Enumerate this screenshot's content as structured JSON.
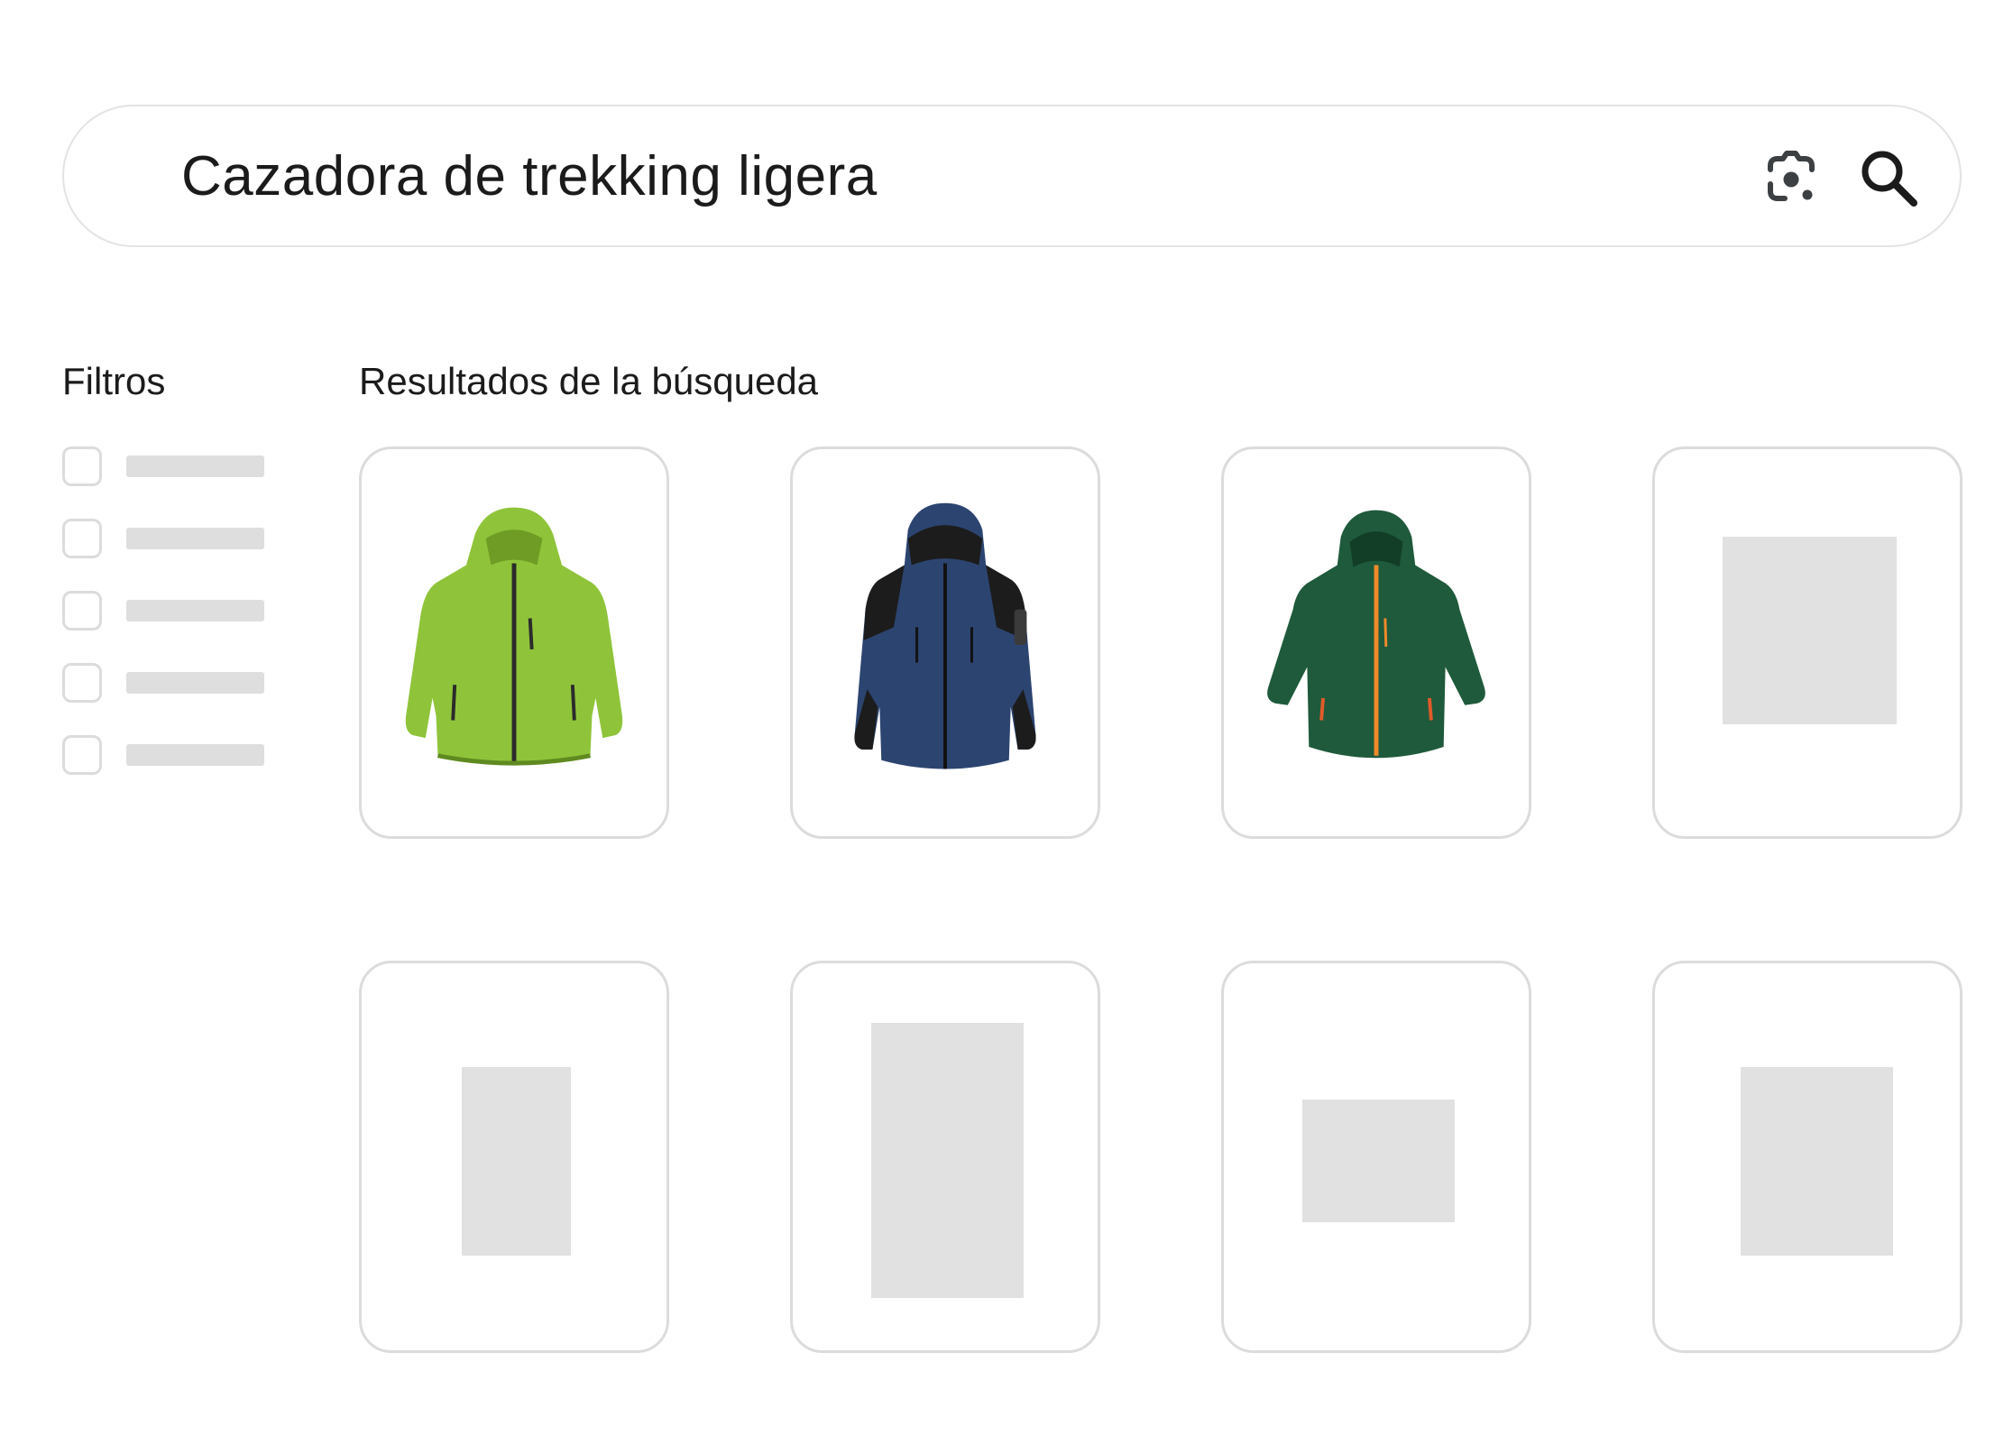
{
  "search": {
    "query": "Cazadora de trekking ligera",
    "lens_icon": "camera-lens-icon",
    "search_icon": "search-icon"
  },
  "filters": {
    "title": "Filtros",
    "items": [
      {
        "checked": false
      },
      {
        "checked": false
      },
      {
        "checked": false
      },
      {
        "checked": false
      },
      {
        "checked": false
      }
    ]
  },
  "results": {
    "title": "Resultados de la búsqueda",
    "products": [
      {
        "image": "green-lime-jacket",
        "colors": {
          "main": "#8fc43a",
          "zip": "#2b2b2b"
        }
      },
      {
        "image": "navy-softshell-jacket",
        "colors": {
          "main": "#2c4470",
          "panel": "#1c1c1c"
        }
      },
      {
        "image": "forest-green-jacket",
        "colors": {
          "main": "#1e5a3b",
          "zip": "#f08a2a"
        }
      },
      {
        "image": "placeholder"
      },
      {
        "image": "placeholder"
      },
      {
        "image": "placeholder"
      },
      {
        "image": "placeholder"
      },
      {
        "image": "placeholder"
      }
    ]
  },
  "colors": {
    "border": "#dcdcdc",
    "placeholder": "#e1e1e1",
    "text": "#1b1b1b"
  }
}
